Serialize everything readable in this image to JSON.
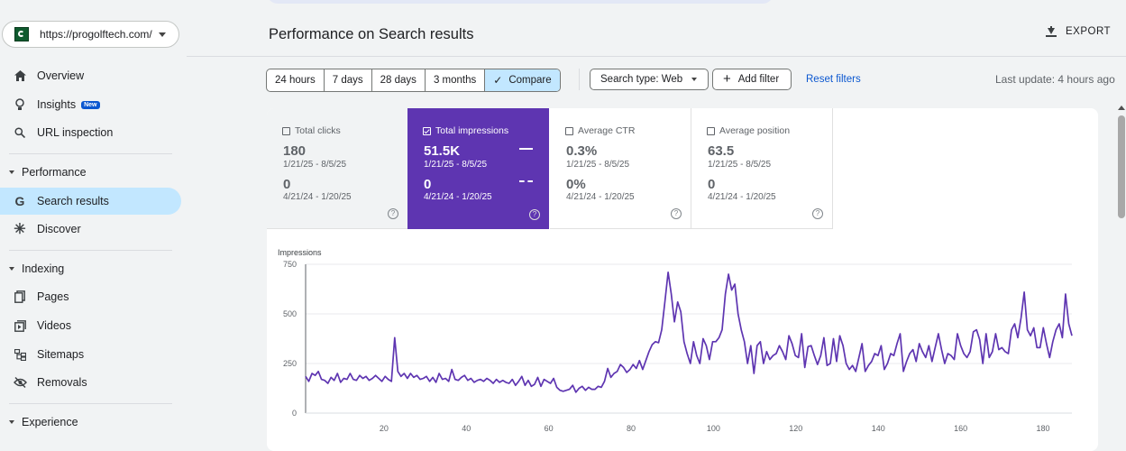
{
  "property": {
    "url": "https://progolftech.com/"
  },
  "nav": {
    "overview": "Overview",
    "insights": "Insights",
    "insights_badge": "New",
    "url_inspection": "URL inspection",
    "performance_section": "Performance",
    "search_results": "Search results",
    "discover": "Discover",
    "indexing_section": "Indexing",
    "pages": "Pages",
    "videos": "Videos",
    "sitemaps": "Sitemaps",
    "removals": "Removals",
    "experience_section": "Experience"
  },
  "header": {
    "title": "Performance on Search results",
    "export": "EXPORT"
  },
  "filters": {
    "ranges": [
      "24 hours",
      "7 days",
      "28 days",
      "3 months"
    ],
    "compare": "Compare",
    "search_type": "Search type: Web",
    "add_filter": "Add filter",
    "reset": "Reset filters",
    "last_update": "Last update: 4 hours ago"
  },
  "metrics": {
    "clicks": {
      "label": "Total clicks",
      "value": "180",
      "range": "1/21/25 - 8/5/25",
      "cmp_value": "0",
      "cmp_range": "4/21/24 - 1/20/25",
      "checked": false
    },
    "impressions": {
      "label": "Total impressions",
      "value": "51.5K",
      "range": "1/21/25 - 8/5/25",
      "cmp_value": "0",
      "cmp_range": "4/21/24 - 1/20/25",
      "checked": true
    },
    "ctr": {
      "label": "Average CTR",
      "value": "0.3%",
      "range": "1/21/25 - 8/5/25",
      "cmp_value": "0%",
      "cmp_range": "4/21/24 - 1/20/25",
      "checked": false
    },
    "position": {
      "label": "Average position",
      "value": "63.5",
      "range": "1/21/25 - 8/5/25",
      "cmp_value": "0",
      "cmp_range": "4/21/24 - 1/20/25",
      "checked": false
    }
  },
  "chart_data": {
    "type": "line",
    "ylabel": "Impressions",
    "ylim": [
      0,
      750
    ],
    "yticks": [
      0,
      250,
      500,
      750
    ],
    "xticks": [
      20,
      40,
      60,
      80,
      100,
      120,
      140,
      160,
      180
    ],
    "xlim": [
      1,
      187
    ],
    "line_color": "#5e35b1",
    "grid": true,
    "series": [
      {
        "values": [
          185,
          160,
          200,
          190,
          210,
          170,
          165,
          150,
          180,
          165,
          200,
          155,
          175,
          170,
          200,
          170,
          165,
          190,
          175,
          185,
          165,
          175,
          190,
          175,
          160,
          185,
          170,
          160,
          380,
          210,
          185,
          200,
          175,
          200,
          180,
          190,
          170,
          175,
          185,
          160,
          180,
          155,
          200,
          170,
          175,
          160,
          220,
          170,
          165,
          180,
          190,
          165,
          175,
          155,
          165,
          170,
          160,
          175,
          165,
          150,
          170,
          155,
          165,
          155,
          150,
          170,
          140,
          160,
          185,
          140,
          165,
          135,
          145,
          180,
          135,
          170,
          160,
          150,
          175,
          130,
          115,
          110,
          115,
          120,
          140,
          105,
          125,
          135,
          115,
          130,
          120,
          120,
          135,
          130,
          160,
          225,
          180,
          200,
          210,
          245,
          230,
          205,
          220,
          245,
          225,
          265,
          220,
          265,
          310,
          345,
          360,
          355,
          420,
          560,
          710,
          600,
          460,
          560,
          510,
          360,
          300,
          250,
          360,
          290,
          250,
          375,
          340,
          270,
          360,
          360,
          380,
          420,
          600,
          700,
          620,
          650,
          500,
          420,
          360,
          250,
          340,
          200,
          340,
          360,
          250,
          310,
          270,
          290,
          300,
          340,
          310,
          270,
          390,
          350,
          290,
          280,
          400,
          230,
          335,
          340,
          290,
          245,
          290,
          380,
          240,
          250,
          375,
          260,
          390,
          340,
          250,
          220,
          240,
          210,
          280,
          350,
          210,
          240,
          260,
          300,
          290,
          340,
          220,
          250,
          300,
          290,
          350,
          400,
          210,
          260,
          300,
          320,
          260,
          350,
          310,
          280,
          340,
          260,
          330,
          400,
          320,
          250,
          300,
          290,
          270,
          400,
          340,
          300,
          280,
          310,
          410,
          420,
          370,
          250,
          400,
          280,
          310,
          400,
          320,
          330,
          310,
          300,
          420,
          450,
          380,
          480,
          610,
          420,
          390,
          430,
          330,
          330,
          430,
          350,
          280,
          360,
          420,
          450,
          380,
          600,
          450,
          390
        ]
      }
    ]
  }
}
